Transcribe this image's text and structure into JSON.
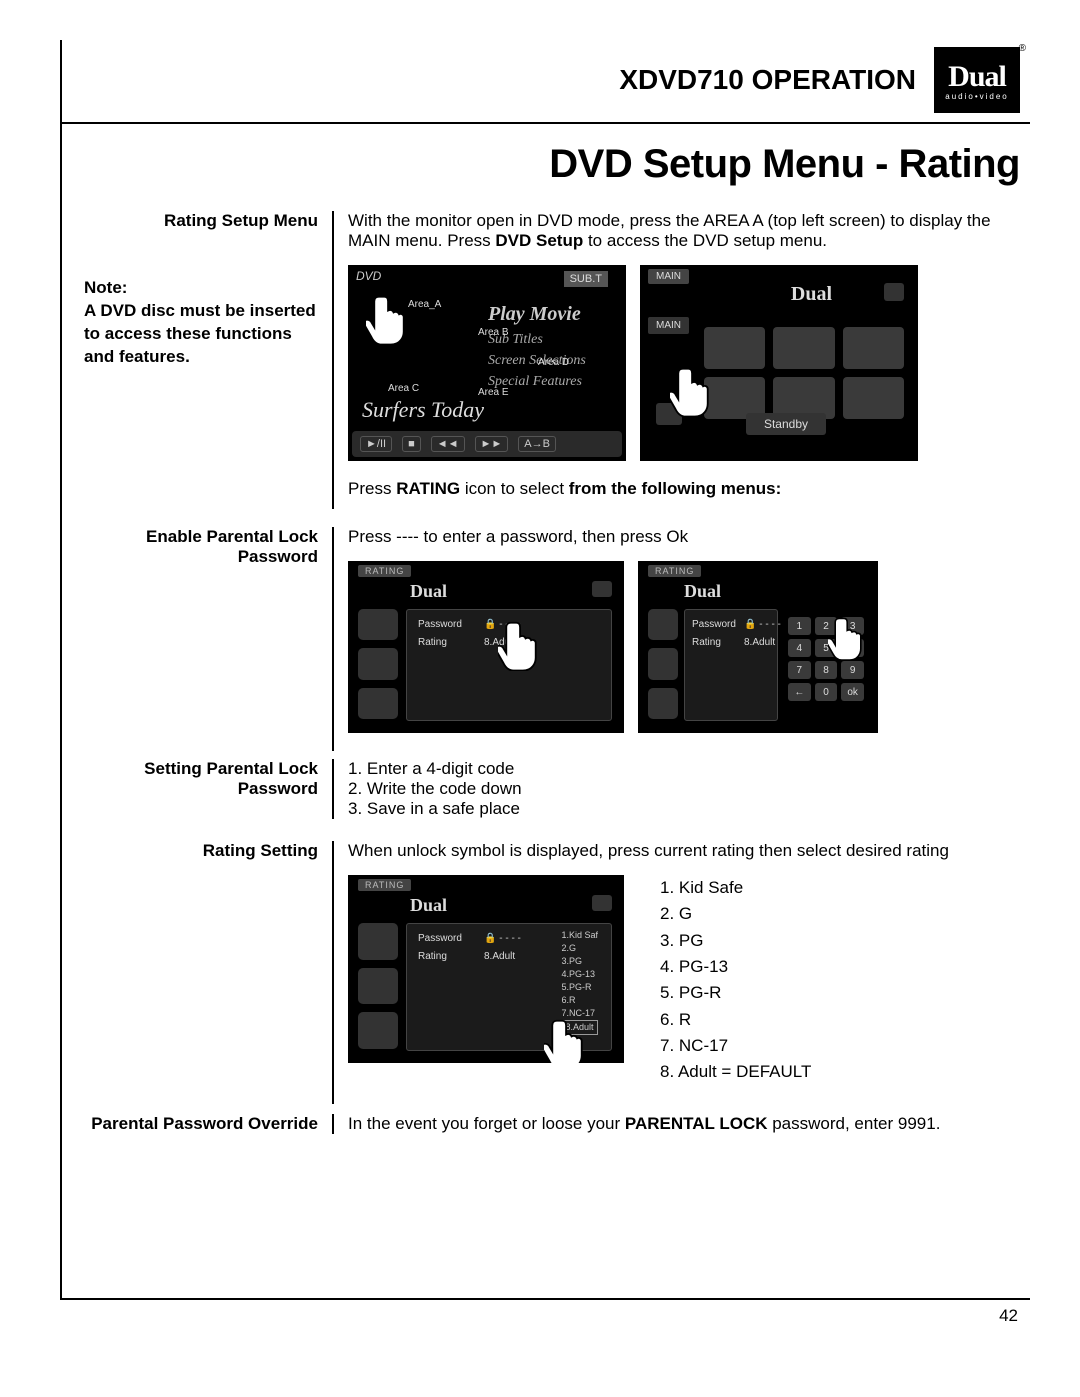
{
  "header": {
    "model": "XDVD710",
    "operation": "OPERATION",
    "brand_main": "Dual",
    "brand_sub": "audio•video",
    "reg": "®"
  },
  "page_title": "DVD Setup Menu - Rating",
  "ratingSetup": {
    "label": "Rating Setup Menu",
    "intro_a": "With the monitor open in DVD mode, press the AREA A (top left screen) to display the MAIN menu. Press ",
    "intro_b": "DVD Setup",
    "intro_c": " to access the DVD setup menu.",
    "note_label": "Note:",
    "note_text": "A DVD disc must be inserted to access these functions and features.",
    "press_a": "Press ",
    "press_b": "RATING",
    "press_c": " icon to select ",
    "press_d": "from the following menus:"
  },
  "enableLock": {
    "label": "Enable Parental Lock Password",
    "text": "Press ---- to enter a password, then press Ok"
  },
  "settingLock": {
    "label": "Setting Parental Lock Password",
    "l1": "1. Enter a 4-digit code",
    "l2": "2. Write the code down",
    "l3": "3. Save in a safe place"
  },
  "ratingSetting": {
    "label": "Rating Setting",
    "text": "When unlock symbol is displayed, press current rating then select desired rating",
    "list": {
      "r1": "1. Kid Safe",
      "r2": "2. G",
      "r3": "3. PG",
      "r4": "4. PG-13",
      "r5": "5. PG-R",
      "r6": "6. R",
      "r7": "7. NC-17",
      "r8": "8. Adult = DEFAULT"
    }
  },
  "override": {
    "label": "Parental Password Override",
    "text_a": "In the event you forget or loose your ",
    "text_b": "PARENTAL LOCK",
    "text_c": " password, enter 9991."
  },
  "shots": {
    "s1": {
      "dvd_top": "DVD",
      "sub": "SUB.T",
      "playmovie": "Play Movie",
      "subtitles": "Sub Titles",
      "screensel": "Screen Selections",
      "specfeat": "Special Features",
      "band": "Surfers Today",
      "areaA": "Area_A",
      "areaB": "Area B",
      "areaC": "Area C",
      "areaD": "Area D",
      "areaE": "Area E",
      "btn_play": "►/II",
      "btn_stop": "■",
      "btn_rew": "◄◄",
      "btn_fwd": "►►",
      "btn_ab": "A→B"
    },
    "s2": {
      "main1": "MAIN",
      "main2": "MAIN",
      "standby": "Standby",
      "logo": "Dual"
    },
    "rshot": {
      "head": "RATING",
      "logo": "Dual",
      "password": "Password",
      "rating": "Rating",
      "lock": "🔒 - - - -",
      "adult": "8.Adult",
      "kp": {
        "1": "1",
        "2": "2",
        "3": "3",
        "4": "4",
        "5": "5",
        "6": "6",
        "7": "7",
        "8": "8",
        "9": "9",
        "b": "←",
        "0": "0",
        "ok": "ok"
      }
    },
    "s5list": {
      "l1": "1.Kid Saf",
      "l2": "2.G",
      "l3": "3.PG",
      "l4": "4.PG-13",
      "l5": "5.PG-R",
      "l6": "6.R",
      "l7": "7.NC-17",
      "l8": "8.Adult"
    }
  },
  "pagenum": "42"
}
